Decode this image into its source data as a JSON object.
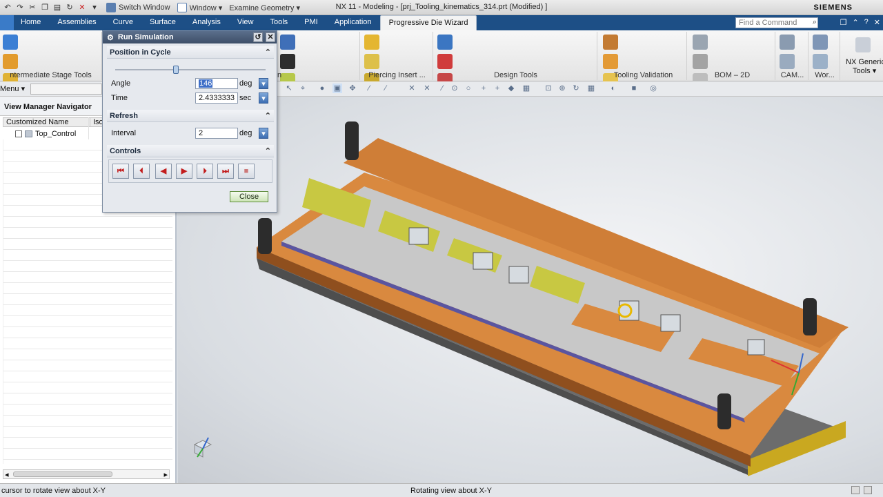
{
  "window": {
    "title": "NX 11 - Modeling - [prj_Tooling_kinematics_314.prt (Modified) ]",
    "brand": "SIEMENS",
    "switch_window": "Switch Window",
    "window_menu": "Window ▾",
    "examine_geometry": "Examine Geometry ▾"
  },
  "tabs": [
    "Home",
    "Assemblies",
    "Curve",
    "Surface",
    "Analysis",
    "View",
    "Tools",
    "PMI",
    "Application",
    "Progressive Die Wizard"
  ],
  "active_tab": "Progressive Die Wizard",
  "command_finder": {
    "placeholder": "Find a Command"
  },
  "ribbon_groups": {
    "intermediate": "ntermediate Stage Tools",
    "partial": "n",
    "piercing": "Piercing Insert ...",
    "design": "Design Tools",
    "validation": "Tooling Validation",
    "bom": "BOM – 2D",
    "cam": "CAM...",
    "work": "Wor...",
    "generic_line1": "NX Generic",
    "generic_line2": "Tools ▾"
  },
  "menubar": {
    "menu": "Menu ▾"
  },
  "navigator": {
    "title": "View Manager Navigator",
    "col_name": "Customized Name",
    "col_iso": "Iso",
    "row_name": "Top_Control"
  },
  "dialog": {
    "title": "Run Simulation",
    "position_section": "Position in Cycle",
    "slider_fraction": 0.4,
    "angle_label": "Angle",
    "angle_value": "146",
    "angle_unit": "deg",
    "time_label": "Time",
    "time_value": "2.4333333",
    "time_unit": "sec",
    "refresh_section": "Refresh",
    "interval_label": "Interval",
    "interval_value": "2",
    "interval_unit": "deg",
    "controls_section": "Controls",
    "close_label": "Close"
  },
  "status": {
    "left": "cursor to rotate view about X-Y",
    "center": "Rotating view about X-Y"
  },
  "colors": {
    "plate_orange": "#d9893f",
    "plate_dark": "#8f4f1e",
    "stripper_gray": "#c8c8c8",
    "strip_yellow": "#c8c842",
    "base_gray": "#6c6c6c",
    "accent_blue": "#1d4f86"
  }
}
